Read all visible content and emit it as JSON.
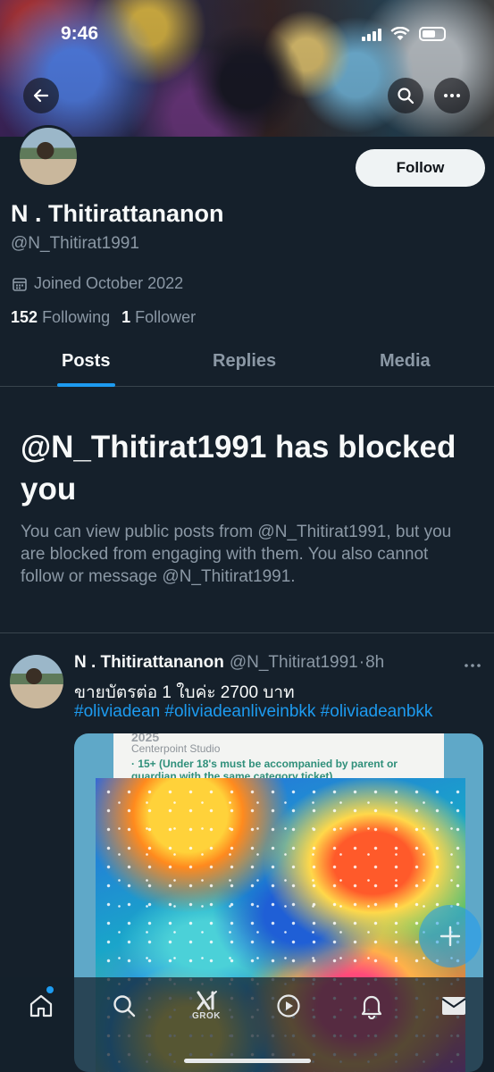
{
  "status_bar": {
    "time": "9:46"
  },
  "profile": {
    "display_name": "N . Thitirattananon",
    "handle": "@N_Thitirat1991",
    "joined": "Joined October 2022",
    "following_count": "152",
    "following_label": "Following",
    "followers_count": "1",
    "followers_label": "Follower",
    "follow_button": "Follow"
  },
  "tabs": [
    {
      "label": "Posts",
      "active": true
    },
    {
      "label": "Replies",
      "active": false
    },
    {
      "label": "Media",
      "active": false
    }
  ],
  "blocked": {
    "title": "@N_Thitirat1991 has blocked you",
    "description": "You can view public posts from @N_Thitirat1991, but you are blocked from engaging with them. You also cannot follow or message @N_Thitirat1991."
  },
  "post": {
    "author": "N . Thitirattananon",
    "handle": "@N_Thitirat1991",
    "separator": "·",
    "time": "8h",
    "text": "ขายบัตรต่อ   1 ใบค่ะ  2700  บาท",
    "hashtags": "#oliviadean #oliviadeanliveinbkk #oliviadeanbkk",
    "media_text": {
      "line1": "2025",
      "venue": "Centerpoint Studio",
      "age_note": "· 15+ (Under 18's must be accompanied by parent or guardian with the same category ticket)"
    }
  },
  "bottom_nav": {
    "grok_label": "GROK",
    "items": [
      "home-icon",
      "search-icon",
      "grok-icon",
      "video-icon",
      "bell-icon",
      "mail-icon"
    ]
  },
  "colors": {
    "accent": "#1d9bf0",
    "background": "#15202b",
    "secondary_text": "#8b98a5"
  }
}
